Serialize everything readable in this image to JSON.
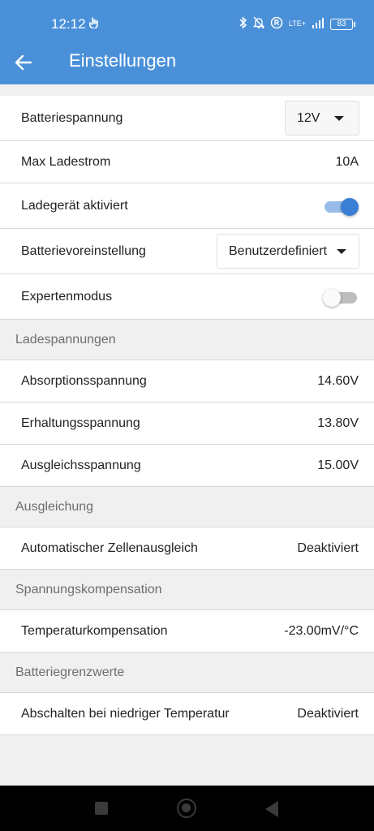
{
  "status_bar": {
    "time": "12:12",
    "network": "LTE+",
    "battery": "83"
  },
  "header": {
    "title": "Einstellungen"
  },
  "settings": {
    "battery_voltage": {
      "label": "Batteriespannung",
      "value": "12V"
    },
    "max_charge_current": {
      "label": "Max Ladestrom",
      "value": "10A"
    },
    "charger_enabled": {
      "label": "Ladegerät aktiviert",
      "state": "on"
    },
    "battery_preset": {
      "label": "Batterievoreinstellung",
      "value": "Benutzerdefiniert"
    },
    "expert_mode": {
      "label": "Expertenmodus",
      "state": "off"
    }
  },
  "sections": {
    "charge_voltages": {
      "title": "Ladespannungen",
      "items": [
        {
          "label": "Absorptionsspannung",
          "value": "14.60V"
        },
        {
          "label": "Erhaltungsspannung",
          "value": "13.80V"
        },
        {
          "label": "Ausgleichsspannung",
          "value": "15.00V"
        }
      ]
    },
    "equalization": {
      "title": "Ausgleichung",
      "items": [
        {
          "label": "Automatischer Zellenausgleich",
          "value": "Deaktiviert"
        }
      ]
    },
    "voltage_compensation": {
      "title": "Spannungskompensation",
      "items": [
        {
          "label": "Temperaturkompensation",
          "value": "-23.00mV/°C"
        }
      ]
    },
    "battery_limits": {
      "title": "Batteriegrenzwerte",
      "items": [
        {
          "label": "Abschalten bei niedriger Temperatur",
          "value": "Deaktiviert"
        }
      ]
    }
  },
  "colors": {
    "app_bar": "#4a90d9",
    "toggle_on": "#3a7fd5"
  }
}
